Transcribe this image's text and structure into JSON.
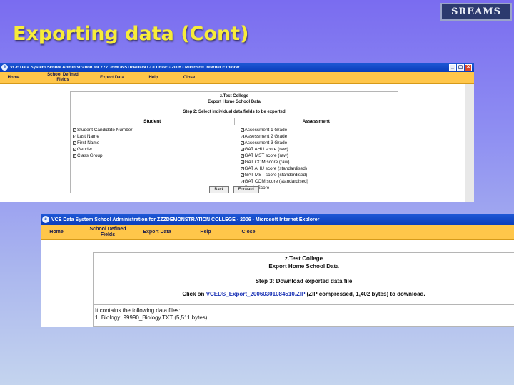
{
  "slide": {
    "title": "Exporting data (Cont)",
    "logo_text": "SREAMS"
  },
  "window1": {
    "title": "VCE Data System School Administration for ZZZDEMONSTRATION COLLEGE - 2006 - Microsoft Internet Explorer",
    "controls": [
      "_",
      "▢",
      "✕"
    ],
    "menu": [
      "Home",
      "School Defined Fields",
      "Export Data",
      "Help",
      "Close"
    ],
    "panel": {
      "school": "z.Test College",
      "heading": "Export Home School Data",
      "step": "Step 2: Select individual data fields to be exported",
      "student_header": "Student",
      "assessment_header": "Assessment",
      "student_fields": [
        "Student Candidate Number",
        "Last Name",
        "First Name",
        "Gender",
        "Class Group"
      ],
      "assessment_fields": [
        "Assessment 1 Grade",
        "Assessment 2 Grade",
        "Assessment 3 Grade",
        "GAT AHU score (raw)",
        "GAT MST score (raw)",
        "GAT COM score (raw)",
        "GAT AHU score (standardised)",
        "GAT MST score (standardised)",
        "GAT COM score (standardised)",
        "Study Score"
      ],
      "back_label": "Back",
      "forward_label": "Forward"
    }
  },
  "window2": {
    "title": "VCE Data System School Administration for ZZZDEMONSTRATION COLLEGE - 2006 - Microsoft Internet Explorer",
    "menu": [
      "Home",
      "School Defined Fields",
      "Export Data",
      "Help",
      "Close"
    ],
    "panel": {
      "school": "z.Test College",
      "heading": "Export Home School Data",
      "step": "Step 3: Download exported data file",
      "click_on": "Click on",
      "file_link": "VCEDS_Export_20060301084510.ZIP",
      "file_info": "(ZIP compressed, 1,402 bytes) to download.",
      "contains_label": "It contains the following data files:",
      "files": [
        "1. Biology: 99990_Biology.TXT (5,511 bytes)"
      ]
    }
  }
}
